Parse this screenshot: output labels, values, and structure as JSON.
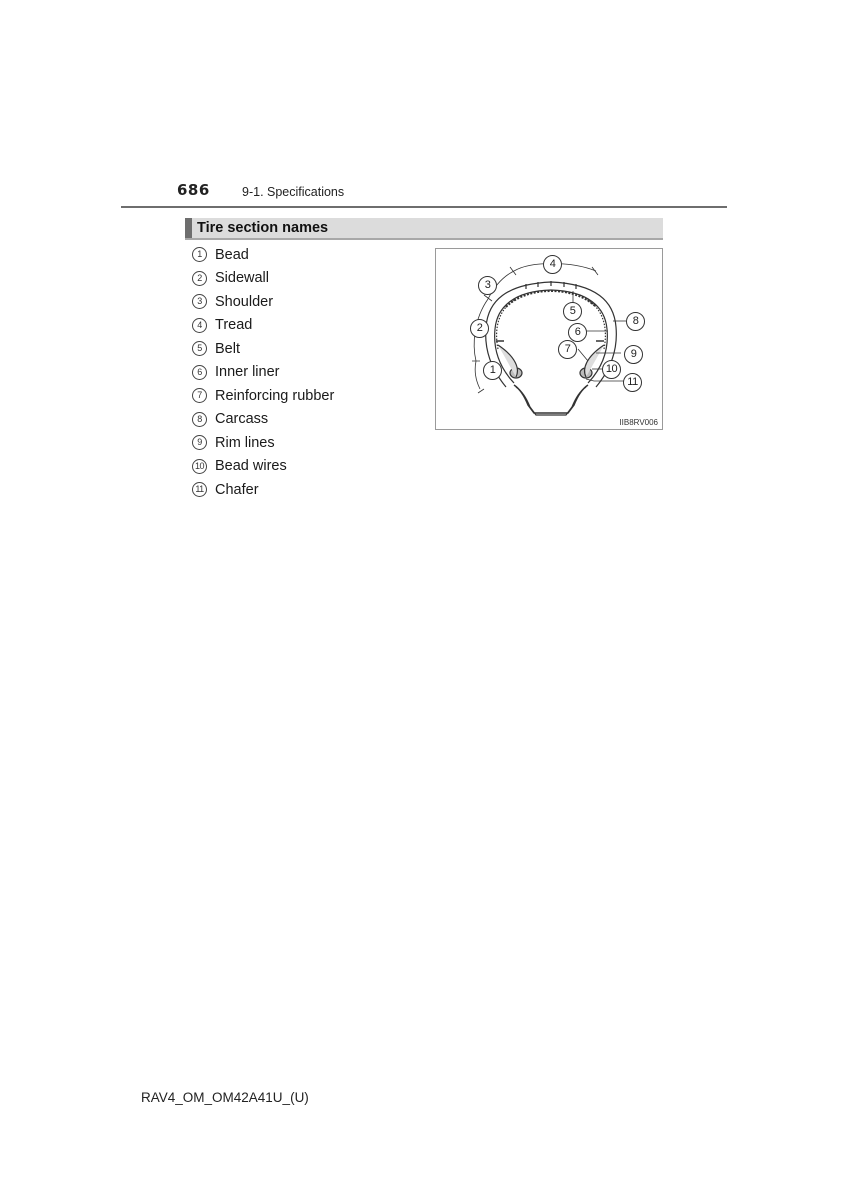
{
  "header": {
    "page_number": "686",
    "section": "9-1. Specifications"
  },
  "section": {
    "title": "Tire section names"
  },
  "parts": [
    {
      "number": "1",
      "name": "Bead"
    },
    {
      "number": "2",
      "name": "Sidewall"
    },
    {
      "number": "3",
      "name": "Shoulder"
    },
    {
      "number": "4",
      "name": "Tread"
    },
    {
      "number": "5",
      "name": "Belt"
    },
    {
      "number": "6",
      "name": "Inner liner"
    },
    {
      "number": "7",
      "name": "Reinforcing rubber"
    },
    {
      "number": "8",
      "name": "Carcass"
    },
    {
      "number": "9",
      "name": "Rim lines"
    },
    {
      "number": "10",
      "name": "Bead wires"
    },
    {
      "number": "11",
      "name": "Chafer"
    }
  ],
  "figure": {
    "code": "IIB8RV006",
    "callouts": [
      "1",
      "2",
      "3",
      "4",
      "5",
      "6",
      "7",
      "8",
      "9",
      "10",
      "11"
    ]
  },
  "footer": {
    "doc_code": "RAV4_OM_OM42A41U_(U)"
  }
}
